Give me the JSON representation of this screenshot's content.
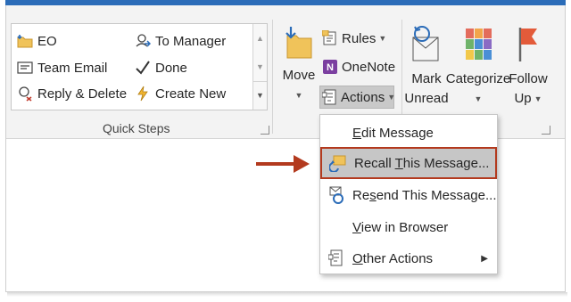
{
  "quick_steps": {
    "items": [
      {
        "label": "EO",
        "icon": "folder-move-icon"
      },
      {
        "label": "To Manager",
        "icon": "forward-user-icon"
      },
      {
        "label": "Team Email",
        "icon": "email-form-icon"
      },
      {
        "label": "Done",
        "icon": "checkmark-icon"
      },
      {
        "label": "Reply & Delete",
        "icon": "reply-delete-icon"
      },
      {
        "label": "Create New",
        "icon": "lightning-icon"
      }
    ],
    "group_label": "Quick Steps"
  },
  "move_group": {
    "move_label": "Move",
    "rules_label": "Rules",
    "onenote_label": "OneNote",
    "actions_label": "Actions"
  },
  "tags_group": {
    "mark_unread_line1": "Mark",
    "mark_unread_line2": "Unread",
    "categorize_label": "Categorize",
    "follow_up_line1": "Follow",
    "follow_up_line2": "Up"
  },
  "actions_menu": {
    "items": [
      {
        "pre": "",
        "accel": "E",
        "post": "dit Message",
        "icon": ""
      },
      {
        "pre": "Recall ",
        "accel": "T",
        "post": "his Message...",
        "icon": "recall-message-icon",
        "highlighted": true
      },
      {
        "pre": "Re",
        "accel": "s",
        "post": "end This Message...",
        "icon": "resend-message-icon"
      },
      {
        "pre": "",
        "accel": "V",
        "post": "iew in Browser",
        "icon": ""
      },
      {
        "pre": "",
        "accel": "O",
        "post": "ther Actions",
        "icon": "other-actions-icon",
        "submenu": true
      }
    ]
  },
  "colors": {
    "accent_blue": "#2b6cb8",
    "highlight_border": "#b33a1e",
    "arrow_color": "#b33a1e"
  }
}
